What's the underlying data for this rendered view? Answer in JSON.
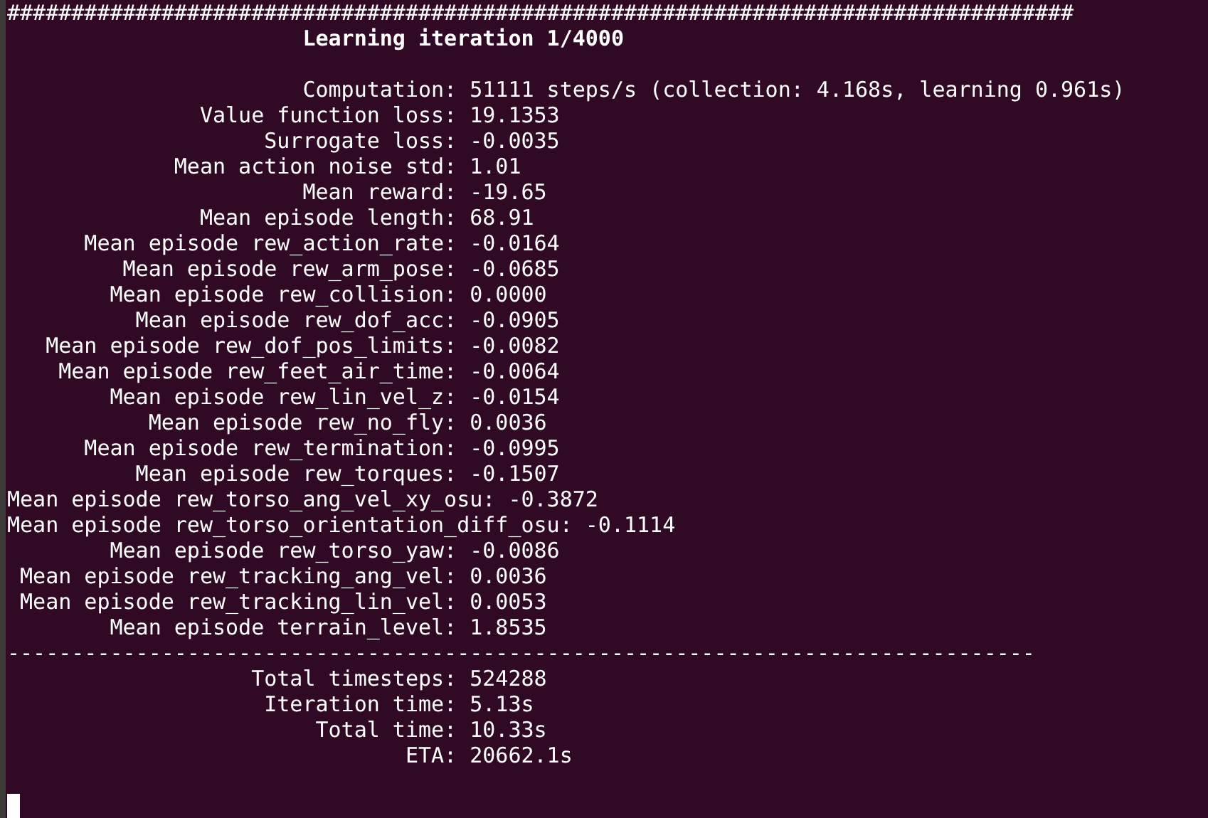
{
  "terminal": {
    "header_rule": "###################################################################################",
    "title": "Learning iteration 1/4000",
    "stats": [
      {
        "label": "Computation:",
        "value": "51111 steps/s (collection: 4.168s, learning 0.961s)"
      },
      {
        "label": "Value function loss:",
        "value": "19.1353"
      },
      {
        "label": "Surrogate loss:",
        "value": "-0.0035"
      },
      {
        "label": "Mean action noise std:",
        "value": "1.01"
      },
      {
        "label": "Mean reward:",
        "value": "-19.65"
      },
      {
        "label": "Mean episode length:",
        "value": "68.91"
      },
      {
        "label": "Mean episode rew_action_rate:",
        "value": "-0.0164"
      },
      {
        "label": "Mean episode rew_arm_pose:",
        "value": "-0.0685"
      },
      {
        "label": "Mean episode rew_collision:",
        "value": "0.0000"
      },
      {
        "label": "Mean episode rew_dof_acc:",
        "value": "-0.0905"
      },
      {
        "label": "Mean episode rew_dof_pos_limits:",
        "value": "-0.0082"
      },
      {
        "label": "Mean episode rew_feet_air_time:",
        "value": "-0.0064"
      },
      {
        "label": "Mean episode rew_lin_vel_z:",
        "value": "-0.0154"
      },
      {
        "label": "Mean episode rew_no_fly:",
        "value": "0.0036"
      },
      {
        "label": "Mean episode rew_termination:",
        "value": "-0.0995"
      },
      {
        "label": "Mean episode rew_torques:",
        "value": "-0.1507"
      },
      {
        "label": "Mean episode rew_torso_ang_vel_xy_osu:",
        "value": "-0.3872"
      },
      {
        "label": "Mean episode rew_torso_orientation_diff_osu:",
        "value": "-0.1114"
      },
      {
        "label": "Mean episode rew_torso_yaw:",
        "value": "-0.0086"
      },
      {
        "label": "Mean episode rew_tracking_ang_vel:",
        "value": "0.0036"
      },
      {
        "label": "Mean episode rew_tracking_lin_vel:",
        "value": "0.0053"
      },
      {
        "label": "Mean episode terrain_level:",
        "value": "1.8535"
      }
    ],
    "separator_rule": "--------------------------------------------------------------------------------",
    "totals": [
      {
        "label": "Total timesteps:",
        "value": "524288"
      },
      {
        "label": "Iteration time:",
        "value": "5.13s"
      },
      {
        "label": "Total time:",
        "value": "10.33s"
      },
      {
        "label": "ETA:",
        "value": "20662.1s"
      }
    ]
  }
}
